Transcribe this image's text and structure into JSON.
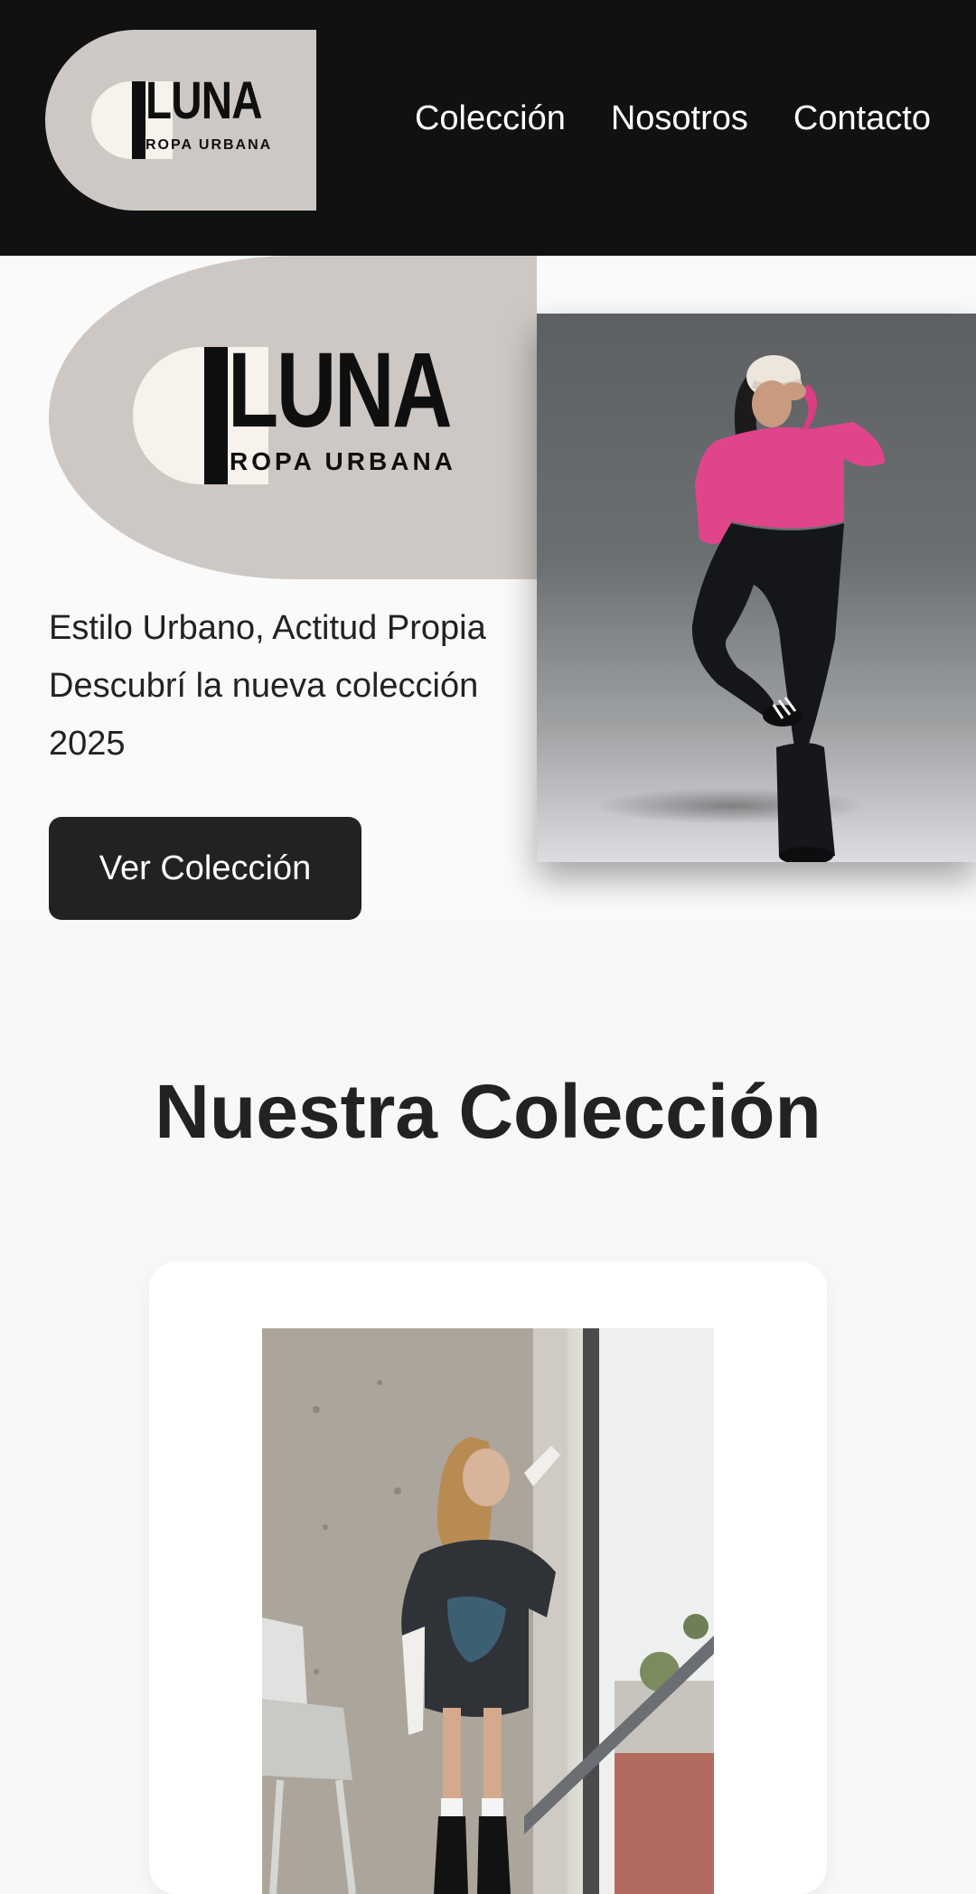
{
  "header": {
    "logo": {
      "brand": "LUNA",
      "tagline": "ROPA URBANA"
    },
    "nav": [
      {
        "label": "Colección"
      },
      {
        "label": "Nosotros"
      },
      {
        "label": "Contacto"
      }
    ]
  },
  "hero": {
    "logo": {
      "brand": "LUNA",
      "tagline": "ROPA URBANA"
    },
    "headline": "Estilo Urbano, Actitud Propia",
    "subtitle": "Descubrí la nueva colección 2025",
    "cta_label": "Ver Colección",
    "photo": "woman-pink-sweater-cap-photo"
  },
  "collection": {
    "title": "Nuestra Colección",
    "products": [
      {
        "photo": "woman-oversized-tshirt-window-photo"
      }
    ]
  },
  "colors": {
    "header_bg": "#111111",
    "logo_bg": "#cdc8c3",
    "logo_moon": "#f7f3ec",
    "brand_text": "#0f0f0f",
    "button_bg": "#222222",
    "page_bg": "#f8f8f8",
    "text": "#222222"
  }
}
